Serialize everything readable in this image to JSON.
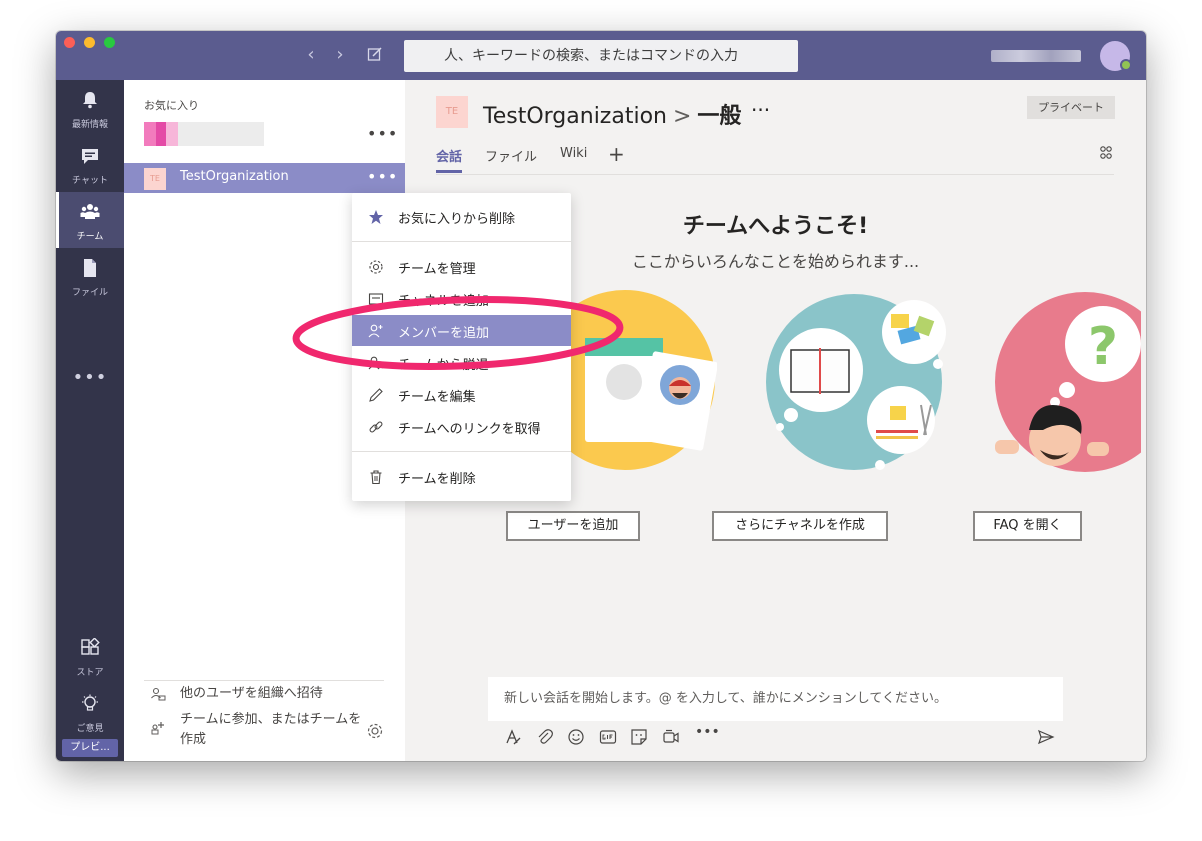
{
  "app": {
    "search_placeholder": "人、キーワードの検索、またはコマンドの入力",
    "nav_back": "‹",
    "nav_forward": "›"
  },
  "rail": {
    "items": [
      {
        "label": "最新情報",
        "icon": "bell-icon"
      },
      {
        "label": "チャット",
        "icon": "chat-icon"
      },
      {
        "label": "チーム",
        "icon": "teams-icon"
      },
      {
        "label": "ファイル",
        "icon": "file-icon"
      }
    ],
    "more": "•••",
    "bottom": [
      {
        "label": "ストア",
        "icon": "store-icon"
      },
      {
        "label": "ご意見",
        "icon": "lightbulb-icon"
      }
    ],
    "preview_badge": "プレビ..."
  },
  "teamlist": {
    "favorites_header": "お気に入り",
    "item_dots": "•••",
    "active_team": {
      "badge": "TE",
      "name": "TestOrganization"
    },
    "footer": {
      "invite": "他のユーザを組織へ招待",
      "join_create_line1": "チームに参加、またはチームを",
      "join_create_line2": "作成"
    }
  },
  "context_menu": {
    "items": [
      {
        "label": "お気に入りから削除",
        "icon": "star-icon"
      },
      {
        "label": "チームを管理",
        "icon": "gear-icon"
      },
      {
        "label": "チャネルを追加",
        "icon": "channel-icon"
      },
      {
        "label": "メンバーを追加",
        "icon": "add-person-icon"
      },
      {
        "label": "チームから脱退",
        "icon": "leave-icon"
      },
      {
        "label": "チームを編集",
        "icon": "pencil-icon"
      },
      {
        "label": "チームへのリンクを取得",
        "icon": "link-icon"
      },
      {
        "label": "チームを削除",
        "icon": "trash-icon"
      }
    ],
    "highlighted_index": 3
  },
  "main": {
    "badge": "TE",
    "team_name": "TestOrganization",
    "separator": ">",
    "channel_name": "一般",
    "more_dots": "···",
    "private_label": "プライベート",
    "tabs": [
      "会話",
      "ファイル",
      "Wiki"
    ],
    "add_tab": "+",
    "welcome_title": "チームへようこそ!",
    "welcome_subtitle": "ここからいろんなことを始められます...",
    "actions": [
      "ユーザーを追加",
      "さらにチャネルを作成",
      "FAQ を開く"
    ],
    "composer_placeholder": "新しい会話を開始します。@ を入力して、誰かにメンションしてください。"
  },
  "colors": {
    "titlebar": "#5b5c8f",
    "rail": "#33344a",
    "accent": "#6264a7",
    "selection": "#8b8cc7",
    "annotation_ellipse": "#f0286e"
  }
}
